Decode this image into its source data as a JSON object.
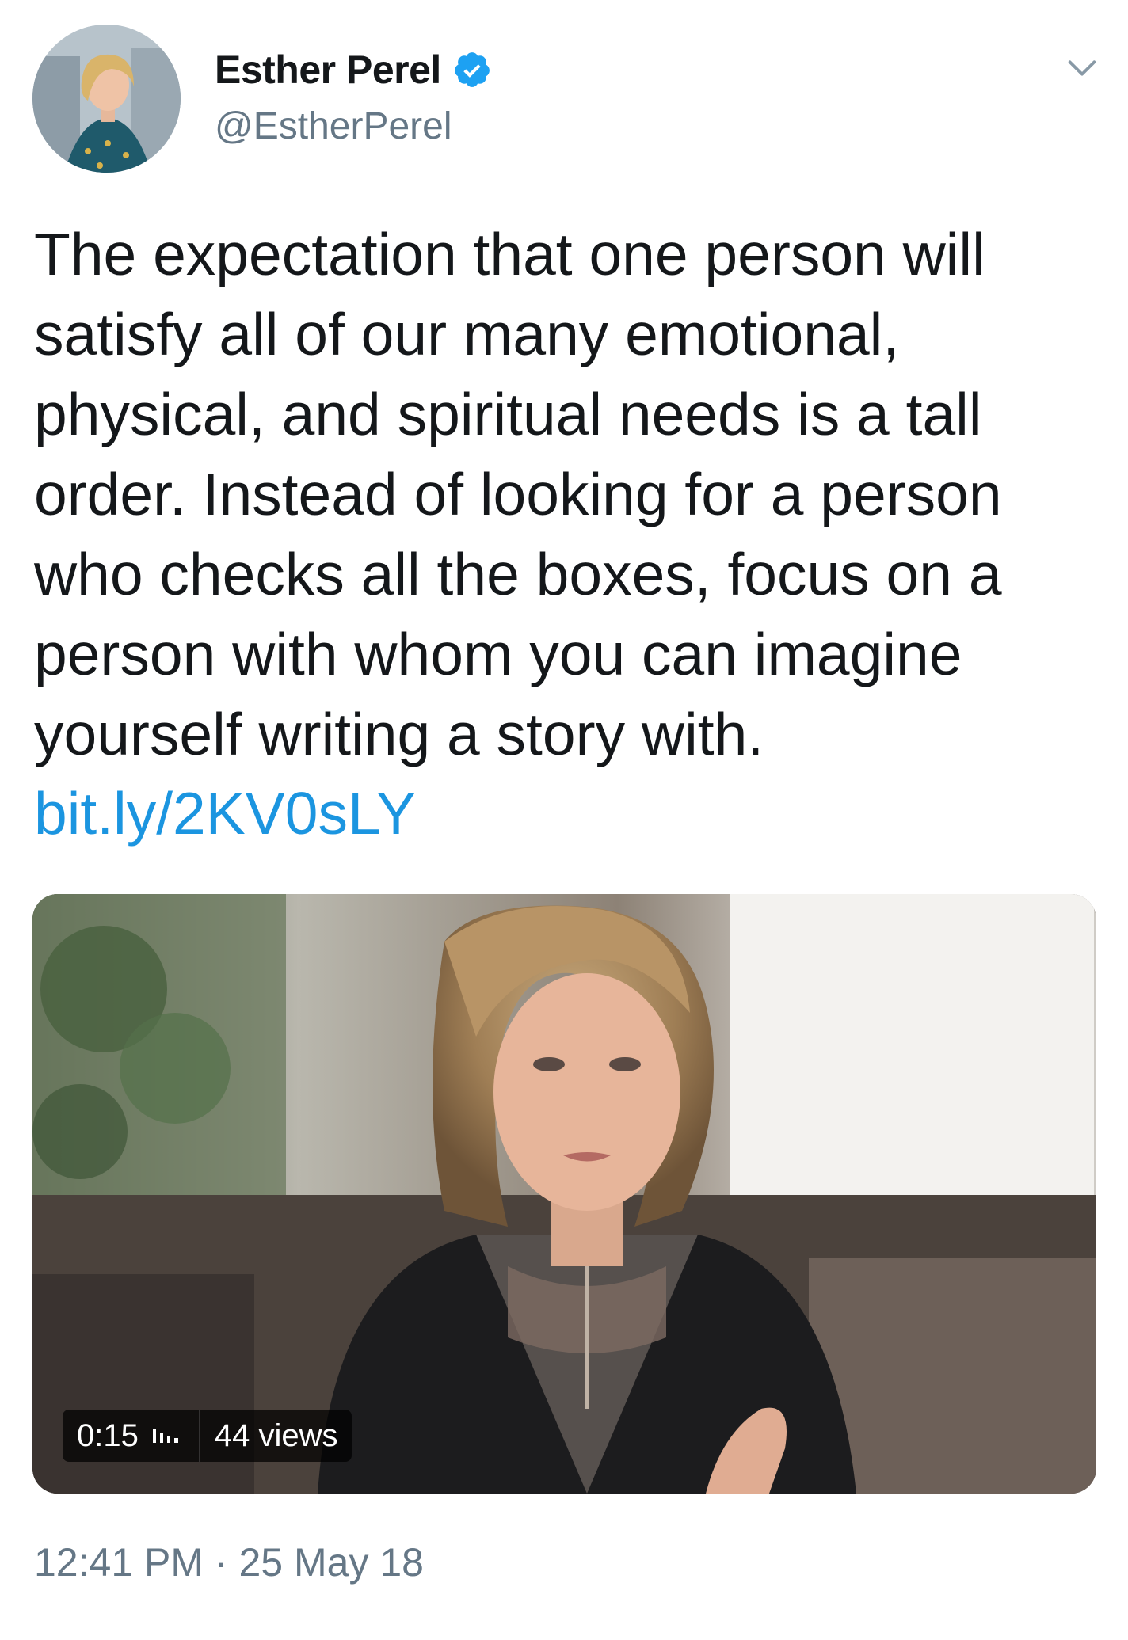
{
  "author": {
    "display_name": "Esther Perel",
    "handle": "@EstherPerel",
    "verified": true
  },
  "tweet": {
    "text": "The expectation that one person will satisfy all of our many emotional, physical, and spiritual needs is a tall order. Instead of looking for a person who checks all the boxes, focus on a person with whom you can imagine yourself writing a story with.",
    "link": "bit.ly/2KV0sLY",
    "time": "12:41 PM",
    "separator": "·",
    "date": "25 May 18"
  },
  "video": {
    "duration": "0:15",
    "views": "44 views"
  },
  "colors": {
    "link": "#1b95e0",
    "verified": "#1da1f2",
    "secondary_text": "#657786",
    "primary_text": "#14171a"
  },
  "icons": {
    "verified": "verified-badge-icon",
    "caret": "chevron-down-icon",
    "audio": "audio-bars-icon"
  }
}
